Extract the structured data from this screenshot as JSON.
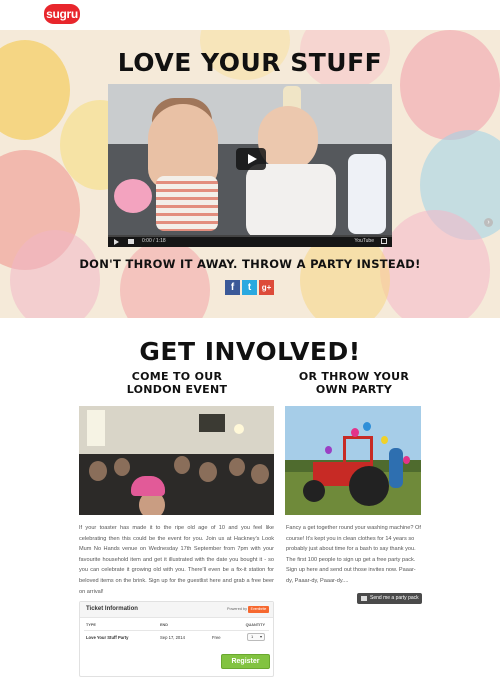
{
  "brand": {
    "logo_text": "sugru",
    "logo_color": "#e8262c"
  },
  "hero": {
    "title": "LOVE YOUR STUFF",
    "tagline": "DON'T THROW IT AWAY. THROW A PARTY INSTEAD!",
    "video": {
      "time": "0:00 / 1:18",
      "progress": 0,
      "watermark": "YouTube"
    },
    "share": [
      {
        "network": "facebook",
        "glyph": "f",
        "color": "#3b5998"
      },
      {
        "network": "twitter",
        "glyph": "t",
        "color": "#2aa9e0"
      },
      {
        "network": "google-plus",
        "glyph": "g+",
        "color": "#dd4b39"
      }
    ],
    "next_glyph": "›"
  },
  "get_involved": {
    "title": "GET INVOLVED!",
    "left": {
      "heading_line1": "COME TO OUR",
      "heading_line2": "LONDON EVENT",
      "text": "If your toaster has made it to the ripe old age of 10 and you feel like celebrating then this could be the event for you. Join us at Hackney's Look Mum No Hands venue on Wednesday 17th September from 7pm with your favourite household item and get it illustrated with the date you bought it - so you can celebrate it growing old with you. There'll even be a fix-it station for beloved items on the brink. Sign up for the guestlist here and grab a free beer on arrival!"
    },
    "right": {
      "heading_line1": "OR THROW YOUR",
      "heading_line2": "OWN PARTY",
      "text": "Fancy a get together round your washing machine? Of course! It's kept you in clean clothes for 14 years so probably just about time for a bash to say thank you. The first 100 people to sign up get a free party pack. Sign up here and send out those invites now. Paaar-dy, Paaar-dy, Paaar-dy....",
      "button_label": "Send me a party pack"
    }
  },
  "ticket": {
    "title": "Ticket Information",
    "powered_by": "Powered by",
    "provider": "Eventbrite",
    "columns": {
      "type": "TYPE",
      "end": "END",
      "quantity": "QUANTITY"
    },
    "rows": [
      {
        "type": "Love Your Stuff Party",
        "end": "Sep 17, 2014",
        "price": "Free",
        "quantity": "1"
      }
    ],
    "register_label": "Register"
  }
}
